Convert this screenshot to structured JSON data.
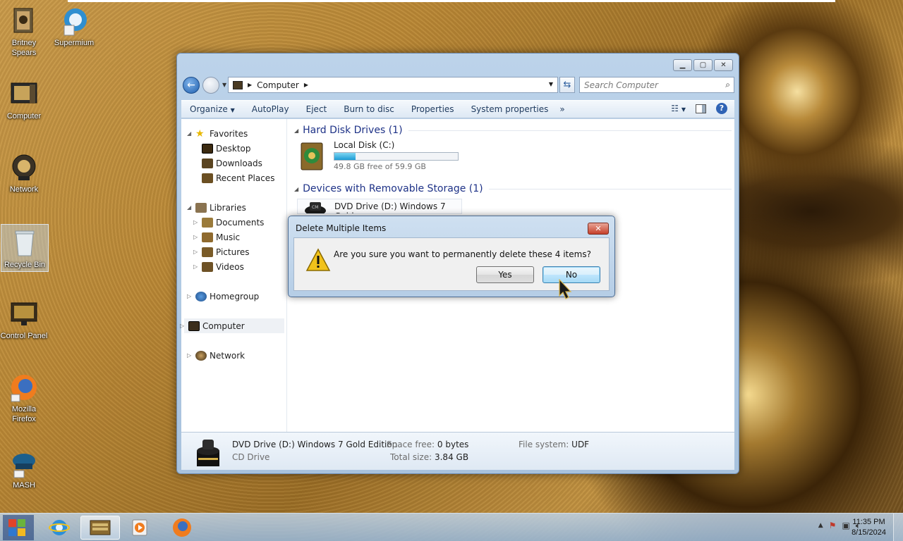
{
  "desktop": {
    "icons": [
      {
        "label": "Britney Spears"
      },
      {
        "label": "Supermium"
      },
      {
        "label": "Computer"
      },
      {
        "label": "Network"
      },
      {
        "label": "Recycle Bin"
      },
      {
        "label": "Control Panel"
      },
      {
        "label": "Mozilla Firefox"
      },
      {
        "label": "MASH"
      }
    ]
  },
  "explorer": {
    "address": {
      "location": "Computer"
    },
    "search_placeholder": "Search Computer",
    "toolbar": {
      "organize": "Organize",
      "autoplay": "AutoPlay",
      "eject": "Eject",
      "burn": "Burn to disc",
      "properties": "Properties",
      "system_properties": "System properties",
      "more": "»"
    },
    "nav": {
      "favorites": "Favorites",
      "desktop": "Desktop",
      "downloads": "Downloads",
      "recent": "Recent Places",
      "libraries": "Libraries",
      "documents": "Documents",
      "music": "Music",
      "pictures": "Pictures",
      "videos": "Videos",
      "homegroup": "Homegroup",
      "computer": "Computer",
      "network": "Network"
    },
    "groups": {
      "hdd": "Hard Disk Drives (1)",
      "removable": "Devices with Removable Storage (1)"
    },
    "local_disk": {
      "name": "Local Disk (C:)",
      "free_text": "49.8 GB free of 59.9 GB",
      "used_fraction": 0.17
    },
    "dvd_item": "DVD Drive (D:) Windows 7 Gold",
    "details": {
      "name": "DVD Drive (D:) Windows 7 Gold Edition",
      "type": "CD Drive",
      "space_free_label": "Space free:",
      "space_free": "0 bytes",
      "total_size_label": "Total size:",
      "total_size": "3.84 GB",
      "fs_label": "File system:",
      "fs": "UDF"
    }
  },
  "dialog": {
    "title": "Delete Multiple Items",
    "message": "Are you sure you want to permanently delete these 4 items?",
    "yes": "Yes",
    "no": "No"
  },
  "taskbar": {
    "time": "11:35 PM",
    "date": "8/15/2024"
  }
}
